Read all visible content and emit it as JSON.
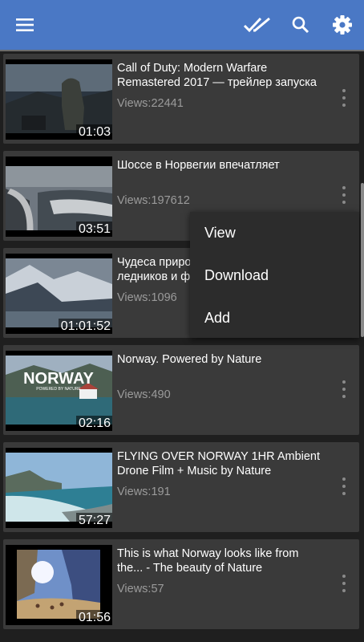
{
  "toolbar": {
    "menu_icon": "hamburger-menu-icon",
    "select_icon": "double-check-icon",
    "search_icon": "search-icon",
    "settings_icon": "gear-icon",
    "background": "#4a78c5"
  },
  "videos": [
    {
      "title": "Call of Duty: Modern Warfare Remastered 2017 — трейлер запуска",
      "views": "Views:22441",
      "duration": "01:03"
    },
    {
      "title": "Шоссе в Норвегии впечатляет",
      "views": "Views:197612",
      "duration": "03:51"
    },
    {
      "title": "Чудеса приро\nледников и ф",
      "views": "Views:1096",
      "duration": "01:01:52"
    },
    {
      "title": "Norway. Powered by Nature",
      "views": "Views:490",
      "duration": "02:16",
      "thumb_text": "NORWAY",
      "thumb_subtext": "POWERED BY NATURE"
    },
    {
      "title": "FLYING OVER NORWAY 1HR Ambient Drone Film + Music by Nature",
      "views": "Views:191",
      "duration": "57:27"
    },
    {
      "title": "This is what Norway looks like from the... - The beauty of Nature",
      "views": "Views:57",
      "duration": "01:56"
    }
  ],
  "context_menu": {
    "items": [
      "View",
      "Download",
      "Add"
    ]
  }
}
